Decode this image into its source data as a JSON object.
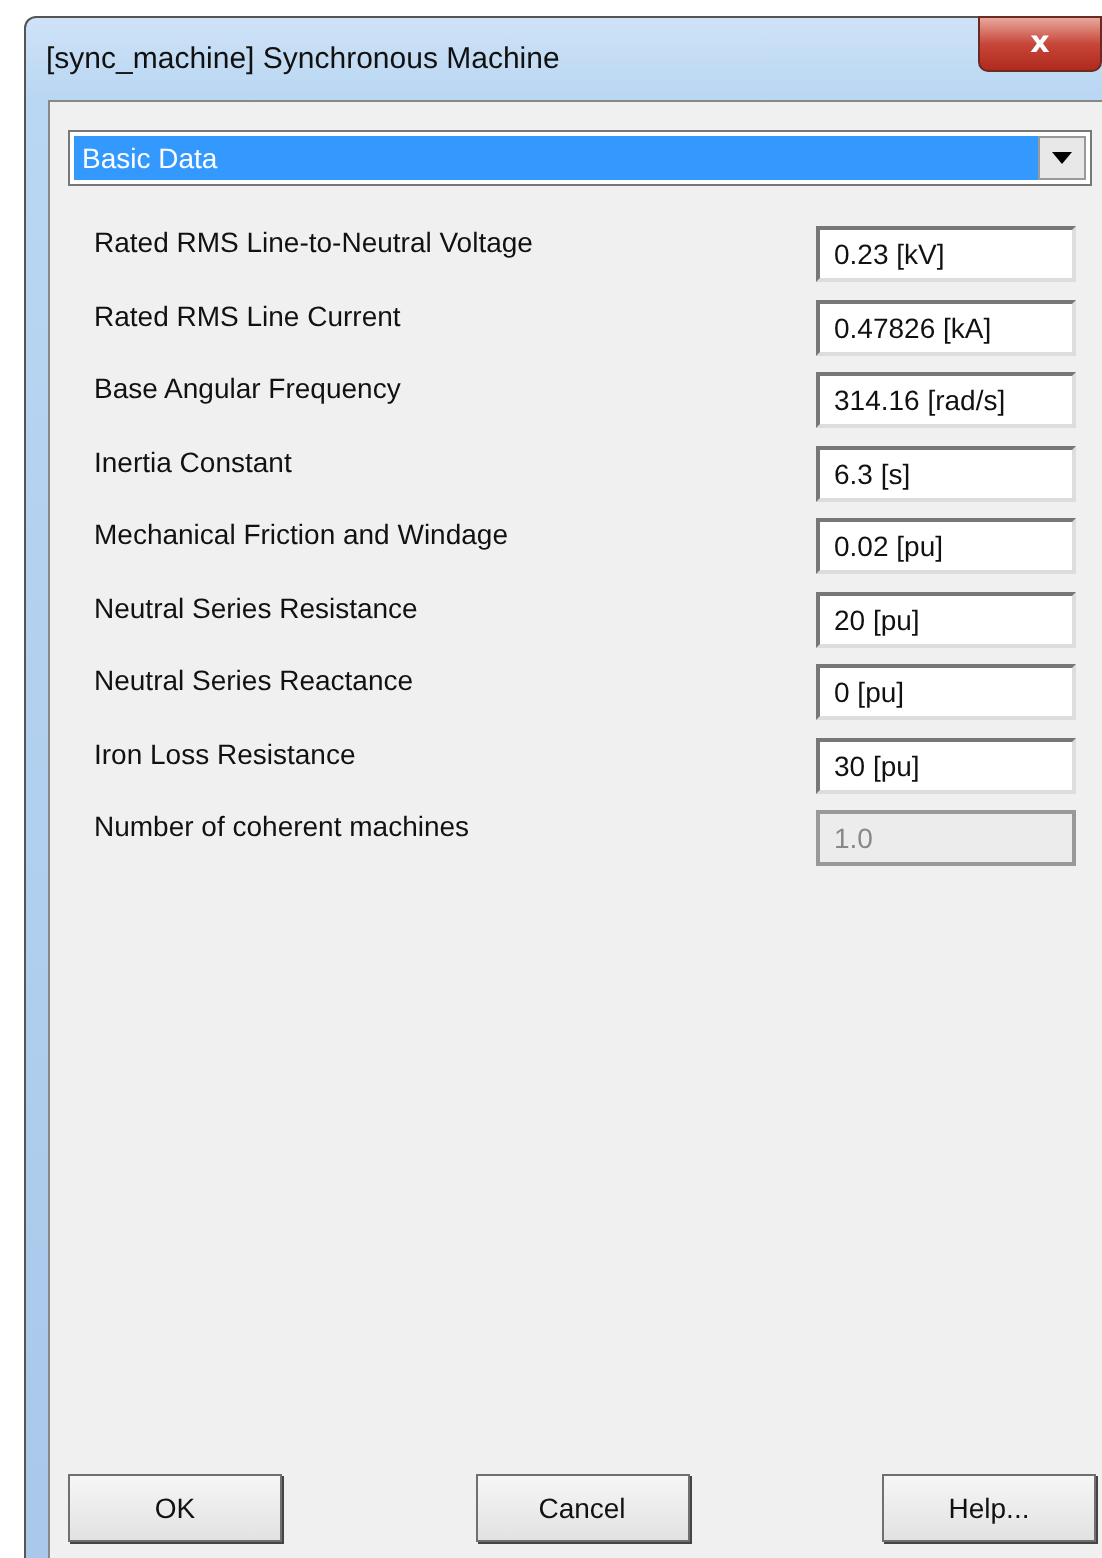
{
  "window": {
    "title": "[sync_machine] Synchronous Machine",
    "close": "x"
  },
  "page_selector": {
    "value": "Basic Data"
  },
  "fields": [
    {
      "label": "Rated RMS Line-to-Neutral Voltage",
      "value": "0.23 [kV]",
      "disabled": false
    },
    {
      "label": "Rated RMS Line Current",
      "value": "0.47826 [kA]",
      "disabled": false
    },
    {
      "label": "Base Angular Frequency",
      "value": "314.16 [rad/s]",
      "disabled": false
    },
    {
      "label": "Inertia Constant",
      "value": "6.3 [s]",
      "disabled": false
    },
    {
      "label": "Mechanical Friction and Windage",
      "value": "0.02 [pu]",
      "disabled": false
    },
    {
      "label": "Neutral Series Resistance",
      "value": "20 [pu]",
      "disabled": false
    },
    {
      "label": "Neutral Series Reactance",
      "value": "0 [pu]",
      "disabled": false
    },
    {
      "label": "Iron Loss Resistance",
      "value": "30 [pu]",
      "disabled": false
    },
    {
      "label": "Number of coherent machines",
      "value": "1.0",
      "disabled": true
    }
  ],
  "buttons": [
    "OK",
    "Cancel",
    "Help..."
  ]
}
